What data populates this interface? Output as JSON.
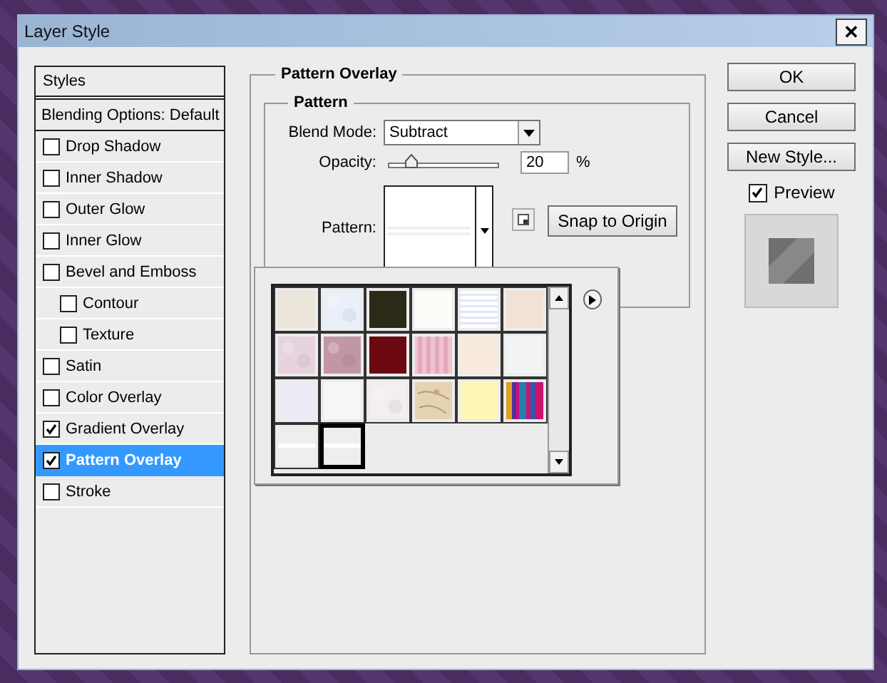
{
  "window": {
    "title": "Layer Style",
    "close": "✕"
  },
  "styles_list": {
    "header": "Styles",
    "items": [
      {
        "label": "Blending Options: Default",
        "kind": "option",
        "selected": false
      },
      {
        "label": "Drop Shadow",
        "kind": "effect",
        "checked": false,
        "selected": false
      },
      {
        "label": "Inner Shadow",
        "kind": "effect",
        "checked": false,
        "selected": false
      },
      {
        "label": "Outer Glow",
        "kind": "effect",
        "checked": false,
        "selected": false
      },
      {
        "label": "Inner Glow",
        "kind": "effect",
        "checked": false,
        "selected": false
      },
      {
        "label": "Bevel and Emboss",
        "kind": "effect",
        "checked": false,
        "selected": false,
        "children": [
          {
            "label": "Contour",
            "kind": "effect",
            "checked": false,
            "selected": false
          },
          {
            "label": "Texture",
            "kind": "effect",
            "checked": false,
            "selected": false
          }
        ]
      },
      {
        "label": "Satin",
        "kind": "effect",
        "checked": false,
        "selected": false
      },
      {
        "label": "Color Overlay",
        "kind": "effect",
        "checked": false,
        "selected": false
      },
      {
        "label": "Gradient Overlay",
        "kind": "effect",
        "checked": true,
        "selected": false
      },
      {
        "label": "Pattern Overlay",
        "kind": "effect",
        "checked": true,
        "selected": true
      },
      {
        "label": "Stroke",
        "kind": "effect",
        "checked": false,
        "selected": false
      }
    ]
  },
  "pattern_overlay": {
    "title": "Pattern Overlay",
    "group": {
      "title": "Pattern",
      "blend_mode": {
        "label": "Blend Mode:",
        "value": "Subtract"
      },
      "opacity": {
        "label": "Opacity:",
        "level": 0.2,
        "value": "20",
        "unit": "%"
      },
      "pattern": {
        "label": "Pattern:"
      },
      "snap_button": "Snap to Origin"
    }
  },
  "pattern_picker": {
    "swatches": [
      {
        "kind": "plain",
        "color": "#ece6da",
        "selected": false
      },
      {
        "kind": "noise",
        "color": "#eaf0fa",
        "selected": false
      },
      {
        "kind": "plain",
        "color": "#2b2a16",
        "selected": false
      },
      {
        "kind": "plain",
        "color": "#fcfbf8",
        "selected": false
      },
      {
        "kind": "hstripes",
        "color": "#dfe6fb",
        "selected": false
      },
      {
        "kind": "plain",
        "color": "#f3e1d8",
        "selected": false
      },
      {
        "kind": "noise",
        "color": "#e6d3de",
        "selected": false
      },
      {
        "kind": "noise",
        "color": "#c196a6",
        "selected": false
      },
      {
        "kind": "plain",
        "color": "#6c0810",
        "selected": false
      },
      {
        "kind": "vstripes",
        "color": "#e3a9bb",
        "selected": false
      },
      {
        "kind": "plain",
        "color": "#f8ebdd",
        "selected": false
      },
      {
        "kind": "plain",
        "color": "#f3f3f3",
        "selected": false
      },
      {
        "kind": "plain",
        "color": "#eeebf7",
        "selected": false
      },
      {
        "kind": "plain",
        "color": "#f6f6f6",
        "selected": false
      },
      {
        "kind": "noise",
        "color": "#f4eeee",
        "selected": false
      },
      {
        "kind": "marble",
        "color": "#e5d4b4",
        "selected": false
      },
      {
        "kind": "plain",
        "color": "#fff6b6",
        "selected": false
      },
      {
        "kind": "multicolor",
        "color": "#c8126e",
        "selected": false
      },
      {
        "kind": "dashes",
        "color": "#eeeeee",
        "selected": false
      },
      {
        "kind": "dashes",
        "color": "#eeeeee",
        "selected": true
      }
    ]
  },
  "buttons": [
    "OK",
    "Cancel",
    "New Style..."
  ],
  "preview": {
    "label": "Preview",
    "checked": true
  }
}
